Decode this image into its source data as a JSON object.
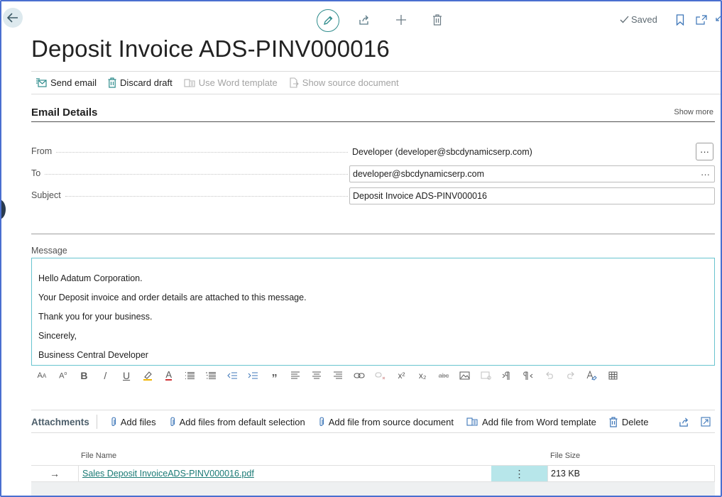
{
  "header": {
    "saved_label": "Saved",
    "title": "Deposit Invoice ADS-PINV000016"
  },
  "actions": {
    "send_email": "Send email",
    "discard_draft": "Discard draft",
    "use_word_template": "Use Word template",
    "show_source_document": "Show source document"
  },
  "email_details": {
    "title": "Email Details",
    "show_more": "Show more",
    "from_label": "From",
    "from_value": "Developer (developer@sbcdynamicserp.com)",
    "to_label": "To",
    "to_value": "developer@sbcdynamicserp.com",
    "subject_label": "Subject",
    "subject_value": "Deposit Invoice ADS-PINV000016",
    "ellipsis": "···"
  },
  "message": {
    "label": "Message",
    "lines": [
      "Hello Adatum Corporation.",
      "Your Deposit invoice and order details are attached to this message.",
      "Thank you for your business.",
      "Sincerely,",
      "Business Central Developer"
    ]
  },
  "toolbar": {
    "bold": "B",
    "italic": "/",
    "underline": "U",
    "font_color": "A",
    "quote": "„",
    "superscript": "x²",
    "subscript": "x₂",
    "strike": "abc"
  },
  "attachments": {
    "title": "Attachments",
    "add_files": "Add files",
    "add_default": "Add files from default selection",
    "add_source": "Add file from source document",
    "add_word": "Add file from Word template",
    "delete": "Delete",
    "col_file_name": "File Name",
    "col_file_size": "File Size",
    "rows": [
      {
        "file_name": "Sales Deposit InvoiceADS-PINV000016.pdf",
        "file_size": "213 KB"
      }
    ]
  },
  "colors": {
    "accent": "#2e8c8c",
    "link": "#1a7a75",
    "frame_border": "#4a6fd0",
    "selected_cell": "#b7e6ea"
  },
  "icons": [
    "back-arrow-icon",
    "pencil-icon",
    "share-icon",
    "plus-icon",
    "trash-icon",
    "check-icon",
    "bookmark-icon",
    "popout-icon",
    "collapse-icon",
    "envelope-icon",
    "word-icon",
    "source-document-icon",
    "paperclip-icon"
  ]
}
